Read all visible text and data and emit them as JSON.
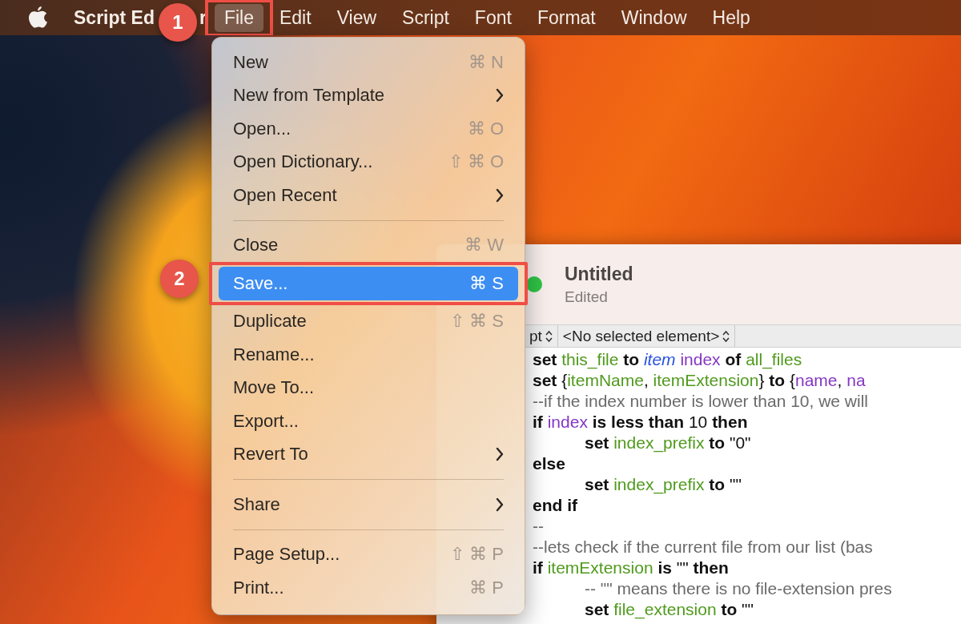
{
  "menu_bar": {
    "app_name_parts": [
      "Script Ed",
      "r"
    ],
    "items": [
      {
        "label": "File",
        "selected": true,
        "highlighted": true
      },
      {
        "label": "Edit",
        "selected": false,
        "highlighted": false
      },
      {
        "label": "View",
        "selected": false,
        "highlighted": false
      },
      {
        "label": "Script",
        "selected": false,
        "highlighted": false
      },
      {
        "label": "Font",
        "selected": false,
        "highlighted": false
      },
      {
        "label": "Format",
        "selected": false,
        "highlighted": false
      },
      {
        "label": "Window",
        "selected": false,
        "highlighted": false
      },
      {
        "label": "Help",
        "selected": false,
        "highlighted": false
      }
    ]
  },
  "file_menu": {
    "items": [
      {
        "kind": "shortcut",
        "label": "New",
        "shortcut": "⌘ N",
        "selected": false,
        "highlighted": false
      },
      {
        "kind": "submenu",
        "label": "New from Template",
        "selected": false,
        "highlighted": false
      },
      {
        "kind": "shortcut",
        "label": "Open...",
        "shortcut": "⌘ O",
        "selected": false,
        "highlighted": false
      },
      {
        "kind": "shortcut",
        "label": "Open Dictionary...",
        "shortcut": "⇧ ⌘ O",
        "selected": false,
        "highlighted": false
      },
      {
        "kind": "submenu",
        "label": "Open Recent",
        "selected": false,
        "highlighted": false
      },
      {
        "kind": "separator"
      },
      {
        "kind": "shortcut",
        "label": "Close",
        "shortcut": "⌘ W",
        "selected": false,
        "highlighted": false
      },
      {
        "kind": "shortcut",
        "label": "Save...",
        "shortcut": "⌘ S",
        "selected": true,
        "highlighted": true
      },
      {
        "kind": "shortcut",
        "label": "Duplicate",
        "shortcut": "⇧ ⌘ S",
        "selected": false,
        "highlighted": false
      },
      {
        "kind": "plain",
        "label": "Rename...",
        "selected": false,
        "highlighted": false
      },
      {
        "kind": "plain",
        "label": "Move To...",
        "selected": false,
        "highlighted": false
      },
      {
        "kind": "plain",
        "label": "Export...",
        "selected": false,
        "highlighted": false
      },
      {
        "kind": "submenu",
        "label": "Revert To",
        "selected": false,
        "highlighted": false
      },
      {
        "kind": "separator"
      },
      {
        "kind": "submenu",
        "label": "Share",
        "selected": false,
        "highlighted": false
      },
      {
        "kind": "separator"
      },
      {
        "kind": "shortcut",
        "label": "Page Setup...",
        "shortcut": "⇧ ⌘ P",
        "selected": false,
        "highlighted": false
      },
      {
        "kind": "shortcut",
        "label": "Print...",
        "shortcut": "⌘ P",
        "selected": false,
        "highlighted": false
      }
    ]
  },
  "callouts": [
    {
      "number": "1"
    },
    {
      "number": "2"
    }
  ],
  "editor_window": {
    "title": "Untitled",
    "subtitle": "Edited",
    "toolbar": {
      "popups": [
        "pt",
        "<No selected element>"
      ]
    },
    "code_lines": [
      {
        "indented": false,
        "segments": [
          {
            "kind": "keyword",
            "text": "set "
          },
          {
            "kind": "variable",
            "text": "this_file"
          },
          {
            "kind": "keyword",
            "text": " to "
          },
          {
            "kind": "term",
            "text": "item"
          },
          {
            "kind": "property",
            "text": " index"
          },
          {
            "kind": "keyword",
            "text": " of "
          },
          {
            "kind": "variable",
            "text": "all_files"
          }
        ]
      },
      {
        "indented": false,
        "segments": [
          {
            "kind": "keyword",
            "text": "set "
          },
          {
            "kind": "plain",
            "text": "{"
          },
          {
            "kind": "variable",
            "text": "itemName"
          },
          {
            "kind": "plain",
            "text": ", "
          },
          {
            "kind": "variable",
            "text": "itemExtension"
          },
          {
            "kind": "plain",
            "text": "} "
          },
          {
            "kind": "keyword",
            "text": "to "
          },
          {
            "kind": "plain",
            "text": "{"
          },
          {
            "kind": "property",
            "text": "name"
          },
          {
            "kind": "plain",
            "text": ", "
          },
          {
            "kind": "property",
            "text": "na"
          }
        ]
      },
      {
        "indented": false,
        "segments": [
          {
            "kind": "comment",
            "text": "--if the index number is lower than 10, we will"
          }
        ]
      },
      {
        "indented": false,
        "segments": [
          {
            "kind": "keyword",
            "text": "if "
          },
          {
            "kind": "property",
            "text": "index"
          },
          {
            "kind": "keyword",
            "text": " is less than "
          },
          {
            "kind": "plain",
            "text": "10"
          },
          {
            "kind": "keyword",
            "text": " then"
          }
        ]
      },
      {
        "indented": true,
        "segments": [
          {
            "kind": "keyword",
            "text": "set "
          },
          {
            "kind": "variable",
            "text": "index_prefix"
          },
          {
            "kind": "keyword",
            "text": " to "
          },
          {
            "kind": "plain",
            "text": "\"0\""
          }
        ]
      },
      {
        "indented": false,
        "segments": [
          {
            "kind": "keyword",
            "text": "else"
          }
        ]
      },
      {
        "indented": true,
        "segments": [
          {
            "kind": "keyword",
            "text": "set "
          },
          {
            "kind": "variable",
            "text": "index_prefix"
          },
          {
            "kind": "keyword",
            "text": " to "
          },
          {
            "kind": "plain",
            "text": "\"\""
          }
        ]
      },
      {
        "indented": false,
        "segments": [
          {
            "kind": "keyword",
            "text": "end if"
          }
        ]
      },
      {
        "indented": false,
        "segments": [
          {
            "kind": "comment",
            "text": "--"
          }
        ]
      },
      {
        "indented": false,
        "segments": [
          {
            "kind": "comment",
            "text": "--lets check if the current file from our list (bas"
          }
        ]
      },
      {
        "indented": false,
        "segments": [
          {
            "kind": "keyword",
            "text": "if "
          },
          {
            "kind": "variable",
            "text": "itemExtension"
          },
          {
            "kind": "keyword",
            "text": " is "
          },
          {
            "kind": "plain",
            "text": "\"\""
          },
          {
            "kind": "keyword",
            "text": " then"
          }
        ]
      },
      {
        "indented": true,
        "segments": [
          {
            "kind": "comment",
            "text": "-- \"\" means there is no file-extension pres"
          }
        ]
      },
      {
        "indented": true,
        "segments": [
          {
            "kind": "keyword",
            "text": "set "
          },
          {
            "kind": "variable",
            "text": "file_extension"
          },
          {
            "kind": "keyword",
            "text": " to "
          },
          {
            "kind": "plain",
            "text": "\"\""
          }
        ]
      }
    ]
  }
}
